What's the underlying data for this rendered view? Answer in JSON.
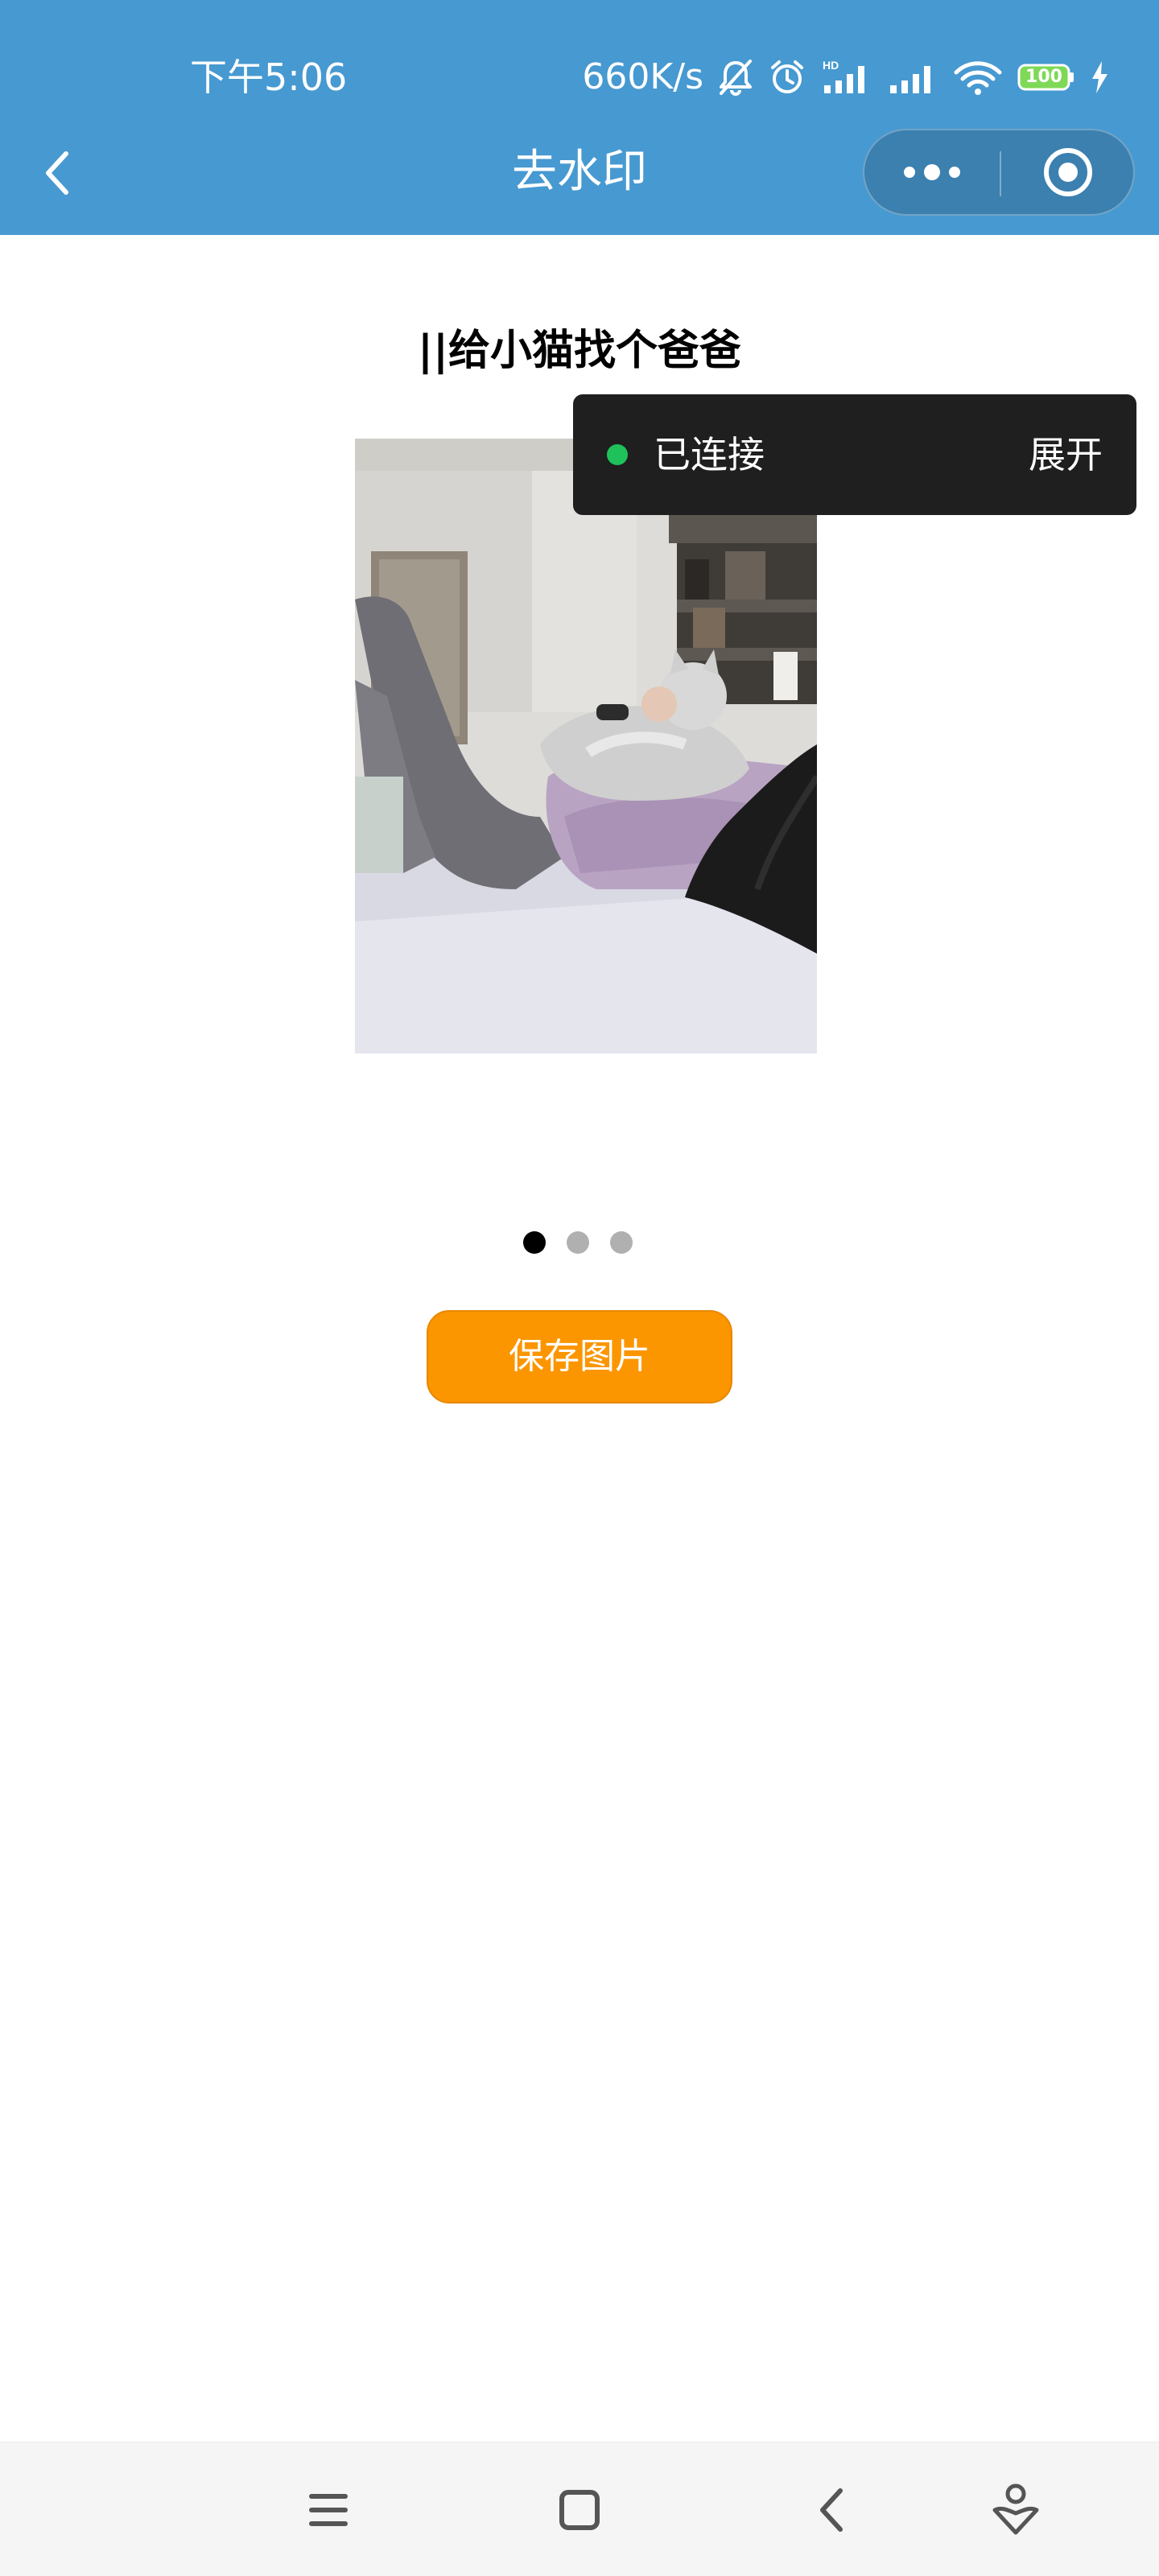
{
  "status_bar": {
    "time": "下午5:06",
    "network_speed": "660K/s",
    "battery_level": "100",
    "icons": [
      "bell-mute-icon",
      "alarm-icon",
      "hd-signal-icon",
      "signal-icon",
      "wifi-icon",
      "battery-icon",
      "charging-icon"
    ]
  },
  "nav_bar": {
    "title": "去水印",
    "icons": [
      "back-icon",
      "more-icon",
      "close-target-icon"
    ]
  },
  "post": {
    "title": "||给小猫找个爸爸"
  },
  "toast": {
    "status": "已连接",
    "action": "展开",
    "dot_color": "#1fc25a"
  },
  "carousel": {
    "count": 3,
    "active_index": 0
  },
  "actions": {
    "save_label": "保存图片"
  },
  "bottom_nav": {
    "icons": [
      "menu-icon",
      "home-square-icon",
      "back-chevron-icon",
      "assistant-icon"
    ]
  },
  "colors": {
    "header": "#4799d1",
    "save_button": "#fb9600",
    "toast_bg": "#1f1f1f"
  }
}
